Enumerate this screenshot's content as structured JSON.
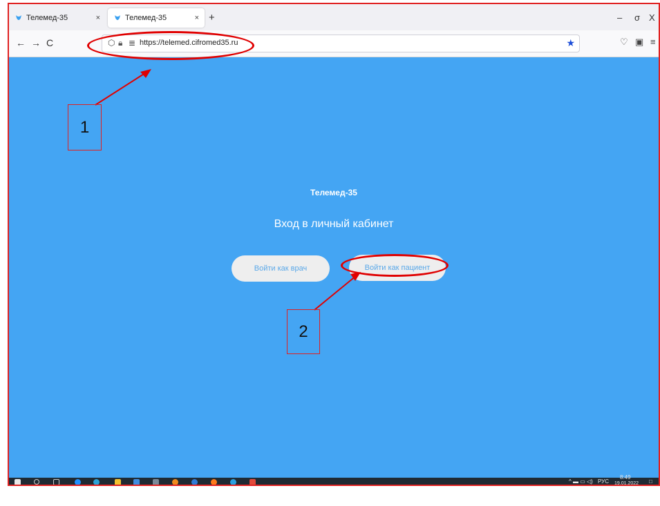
{
  "browser": {
    "tabs": [
      {
        "label": "Телемед-35",
        "close": "×"
      },
      {
        "label": "Телемед-35",
        "close": "×"
      }
    ],
    "new_tab": "+",
    "window_controls": {
      "minimize": "–",
      "restore": "σ",
      "close": "X"
    },
    "nav": {
      "back": "←",
      "forward": "→",
      "reload": "C"
    },
    "address": {
      "url": "https://telemed.cifromed35.ru"
    }
  },
  "page": {
    "brand": "Телемед-35",
    "heading": "Вход в личный кабинет",
    "buttons": {
      "doctor": "Войти как врач",
      "patient": "Войти как пациент"
    }
  },
  "taskbar": {
    "tray_language": "РУС",
    "tray_time": "8:49",
    "tray_date": "19.01.2022"
  },
  "annotations": {
    "callout_1": "1",
    "callout_2": "2"
  },
  "colors": {
    "page_background": "#44a5f3",
    "annotation": "#e00000",
    "button_background": "#eeeeee",
    "button_text": "#5aa8e8"
  }
}
